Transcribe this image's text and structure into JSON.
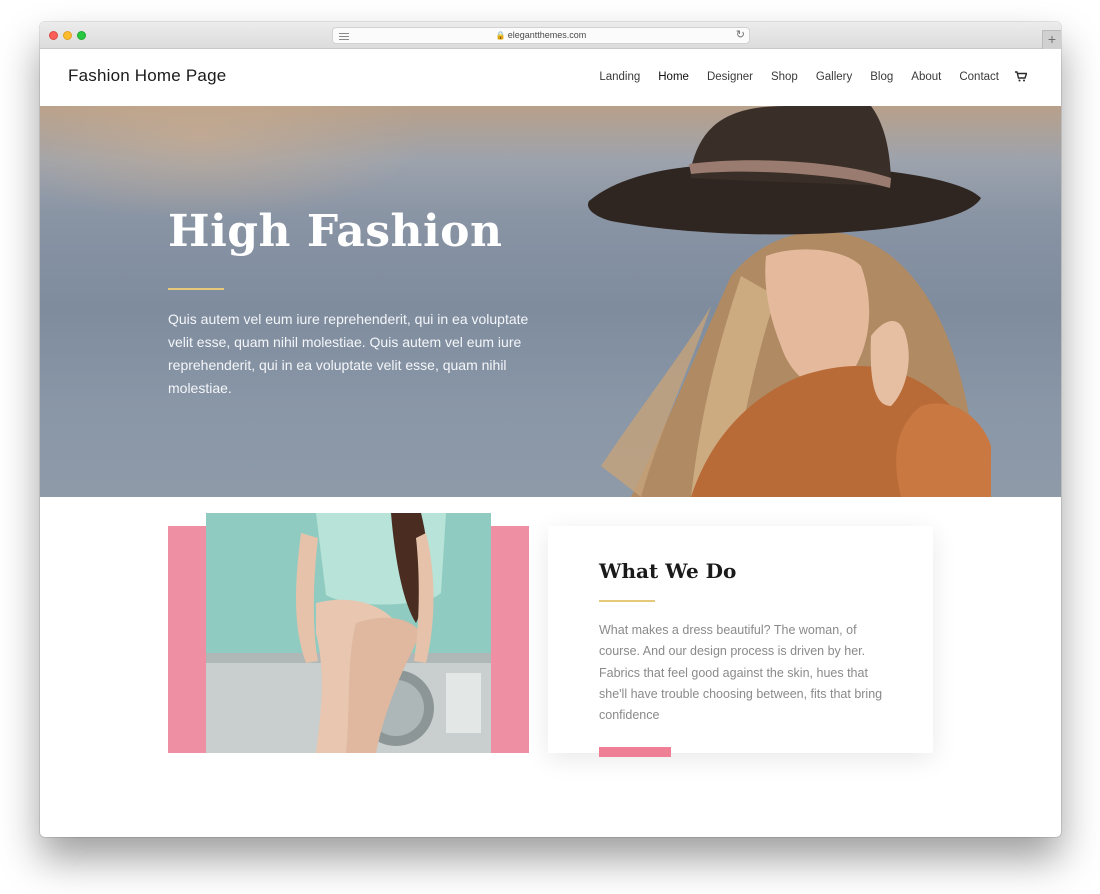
{
  "browser": {
    "url": "elegantthemes.com"
  },
  "header": {
    "logo": "Fashion Home Page",
    "nav": [
      "Landing",
      "Home",
      "Designer",
      "Shop",
      "Gallery",
      "Blog",
      "About",
      "Contact"
    ],
    "active_item": "Home"
  },
  "hero": {
    "title": "High Fashion",
    "text": "Quis autem vel eum iure reprehenderit, qui in ea voluptate velit esse, quam nihil molestiae. Quis autem vel eum iure reprehenderit, qui in ea voluptate velit esse, quam nihil molestiae."
  },
  "about": {
    "title": "What We Do",
    "text": "What makes a dress beautiful? The woman, of course. And our design process is driven by her. Fabrics that feel good against the skin, hues that she'll have trouble choosing between, fits that bring confidence"
  },
  "colors": {
    "accent_gold": "#e5c87a",
    "accent_pink": "#ef8fa3"
  }
}
